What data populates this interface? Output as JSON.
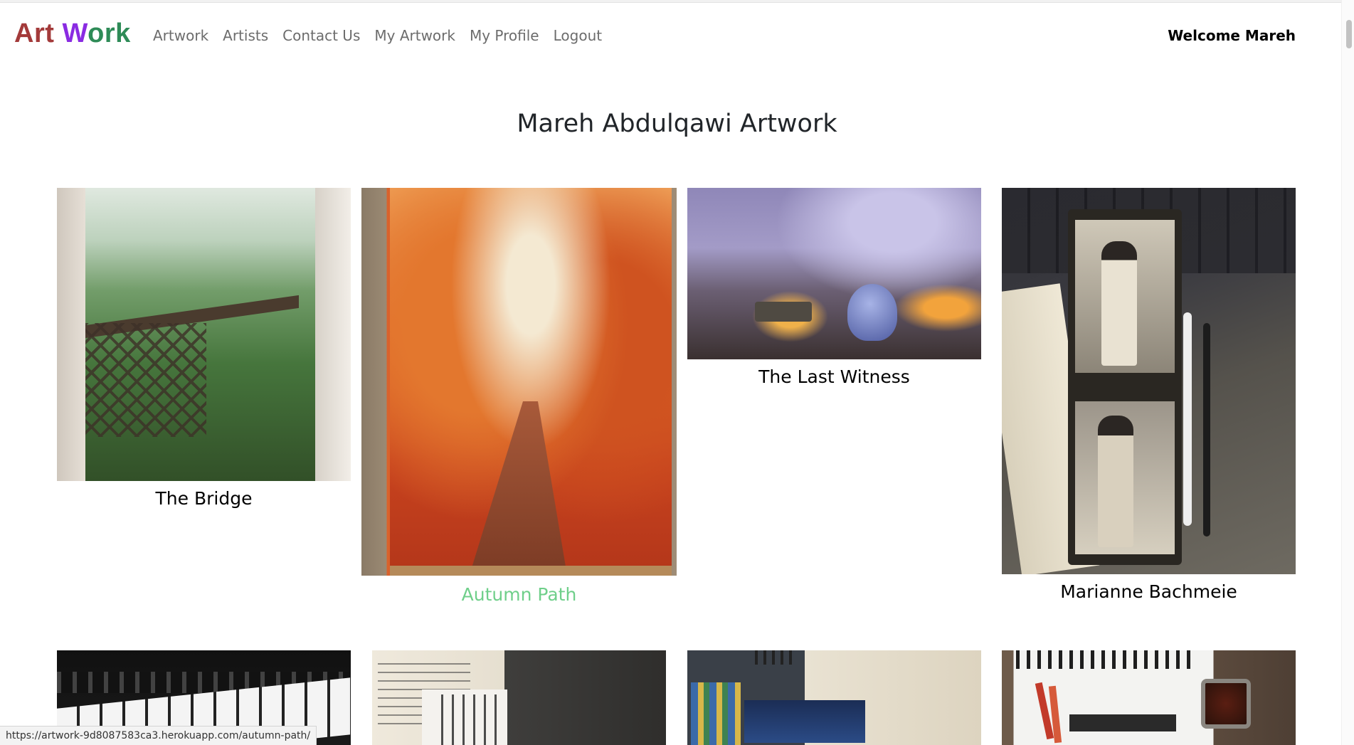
{
  "brand": {
    "part1": "Art",
    "part2_w": "W",
    "part2_rest": "ork"
  },
  "nav": {
    "items": [
      {
        "label": "Artwork"
      },
      {
        "label": "Artists"
      },
      {
        "label": "Contact Us"
      },
      {
        "label": "My Artwork"
      },
      {
        "label": "My Profile"
      },
      {
        "label": "Logout"
      }
    ],
    "welcome": "Welcome Mareh"
  },
  "page": {
    "title": "Mareh Abdulqawi Artwork"
  },
  "gallery": {
    "items": [
      {
        "title": "The Bridge",
        "image_icon": "painting-bridge-forest"
      },
      {
        "title": "Autumn Path",
        "image_icon": "painting-autumn-path",
        "hovered": true
      },
      {
        "title": "The Last Witness",
        "image_icon": "painting-war-city"
      },
      {
        "title": "Marianne Bachmeie",
        "image_icon": "painting-marianne"
      },
      {
        "title": "",
        "image_icon": "photo-piano-keyboard"
      },
      {
        "title": "",
        "image_icon": "photo-arabic-book"
      },
      {
        "title": "",
        "image_icon": "photo-sea-newspaper"
      },
      {
        "title": "",
        "image_icon": "photo-sketchbook"
      }
    ]
  },
  "status_bar": {
    "url": "https://artwork-9d8087583ca3.herokuapp.com/autumn-path/"
  },
  "colors": {
    "brand_art": "#a33a3a",
    "brand_w": "#8a2be2",
    "brand_ork": "#2e8b57",
    "hover_title": "#6fcf8a",
    "nav_link": "#6c6c6c"
  }
}
